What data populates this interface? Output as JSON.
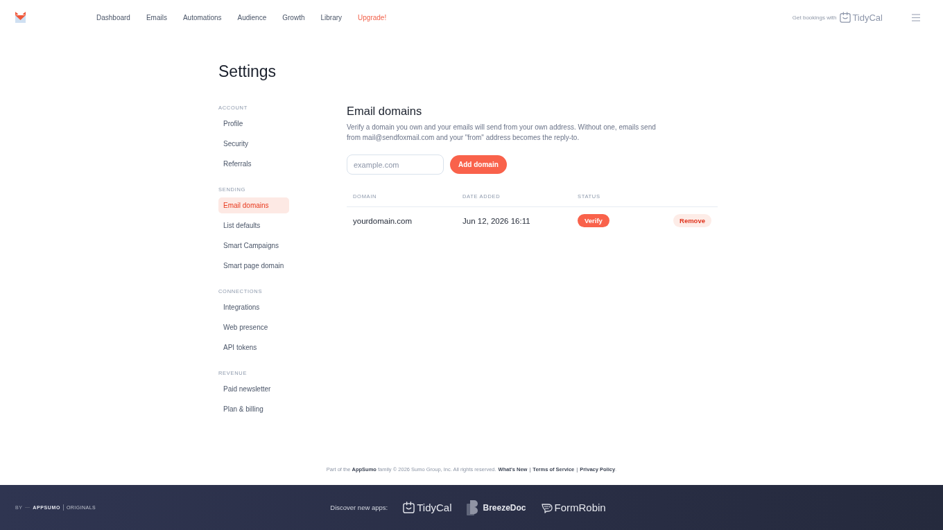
{
  "nav": {
    "items": [
      {
        "label": "Dashboard",
        "kind": "link"
      },
      {
        "label": "Emails",
        "kind": "link"
      },
      {
        "label": "Automations",
        "kind": "link"
      },
      {
        "label": "Audience",
        "kind": "link"
      },
      {
        "label": "Growth",
        "kind": "link"
      },
      {
        "label": "Library",
        "kind": "link"
      },
      {
        "label": "Upgrade!",
        "kind": "upgrade"
      }
    ]
  },
  "promo": {
    "text": "Get bookings with",
    "brand": "TidyCal"
  },
  "page_title": "Settings",
  "sidebar": {
    "sections": [
      {
        "heading": "ACCOUNT",
        "items": [
          {
            "label": "Profile",
            "selected": false
          },
          {
            "label": "Security",
            "selected": false
          },
          {
            "label": "Referrals",
            "selected": false
          }
        ]
      },
      {
        "heading": "SENDING",
        "items": [
          {
            "label": "Email domains",
            "selected": true
          },
          {
            "label": "List defaults",
            "selected": false
          },
          {
            "label": "Smart Campaigns",
            "selected": false
          },
          {
            "label": "Smart page domain",
            "selected": false
          }
        ]
      },
      {
        "heading": "CONNECTIONS",
        "items": [
          {
            "label": "Integrations",
            "selected": false
          },
          {
            "label": "Web presence",
            "selected": false
          },
          {
            "label": "API tokens",
            "selected": false
          }
        ]
      },
      {
        "heading": "REVENUE",
        "items": [
          {
            "label": "Paid newsletter",
            "selected": false
          },
          {
            "label": "Plan & billing",
            "selected": false
          }
        ]
      }
    ]
  },
  "email_domains": {
    "title": "Email domains",
    "description": "Verify a domain you own and your emails will send from your own address. Without one, emails send from mail@sendfoxmail.com and your \"from\" address becomes the reply-to.",
    "domain_input": {
      "placeholder": "example.com"
    },
    "add_button": "Add domain",
    "table": {
      "columns": [
        "DOMAIN",
        "DATE ADDED",
        "STATUS"
      ],
      "rows": [
        {
          "domain": "yourdomain.com",
          "date_added": "Jun 12, 2026 16:11",
          "verify_button": "Verify",
          "remove_button": "Remove"
        }
      ]
    }
  },
  "footer": {
    "parts": [
      {
        "kind": "text",
        "text": "Part of the **AppSumo** family  © 2026 Sumo Group, Inc. All rights reserved."
      },
      {
        "kind": "link",
        "text": "What's New"
      },
      {
        "kind": "separator",
        "text": "|"
      },
      {
        "kind": "link",
        "text": "Terms of Service"
      },
      {
        "kind": "separator",
        "text": "|"
      },
      {
        "kind": "link",
        "text": "Privacy Policy"
      },
      {
        "kind": "text",
        "text": "."
      }
    ]
  },
  "bottom_bar": {
    "by": "BY",
    "brand": "APPSUMO",
    "tagline": "ORIGINALS",
    "discover": "Discover new apps:",
    "apps": [
      {
        "name": "TidyCal",
        "kind": "calendar"
      },
      {
        "name": "BreezeDoc",
        "kind": "blocks"
      },
      {
        "name": "FormRobin",
        "kind": "bubble"
      }
    ]
  }
}
